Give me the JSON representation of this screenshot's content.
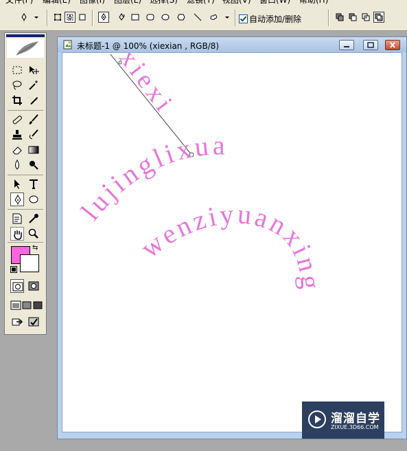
{
  "menu": {
    "items": [
      "文件(F)",
      "编辑(E)",
      "图像(I)",
      "图层(L)",
      "选择(S)",
      "滤镜(T)",
      "视图(V)",
      "窗口(W)",
      "帮助(H)"
    ]
  },
  "options_bar": {
    "auto_add_delete_label": "自动添加/删除",
    "auto_add_delete_checked": true
  },
  "document": {
    "title": "未标题-1 @ 100% (xiexian , RGB/8)"
  },
  "canvas_text": {
    "color": "#e27ad6",
    "path_line_1": "xiexi",
    "path_line_2": "lujinglixua",
    "path_line_3": "wenziyuanxing"
  },
  "colors": {
    "foreground": "#ff66dd",
    "background": "#ffffff"
  },
  "watermark": {
    "name": "溜溜自学",
    "url": "ZIXUE.3D66.COM"
  },
  "icons": [
    "pen-tool-icon",
    "dropdown-arrow-icon",
    "shape-layer-icon",
    "paths-icon",
    "fill-pixels-icon",
    "pen-icon",
    "freeform-pen-icon",
    "rectangle-icon",
    "rounded-rectangle-icon",
    "ellipse-icon",
    "polygon-icon",
    "line-icon",
    "custom-shape-icon",
    "add-path-icon",
    "subtract-path-icon",
    "intersect-path-icon",
    "exclude-path-icon"
  ]
}
